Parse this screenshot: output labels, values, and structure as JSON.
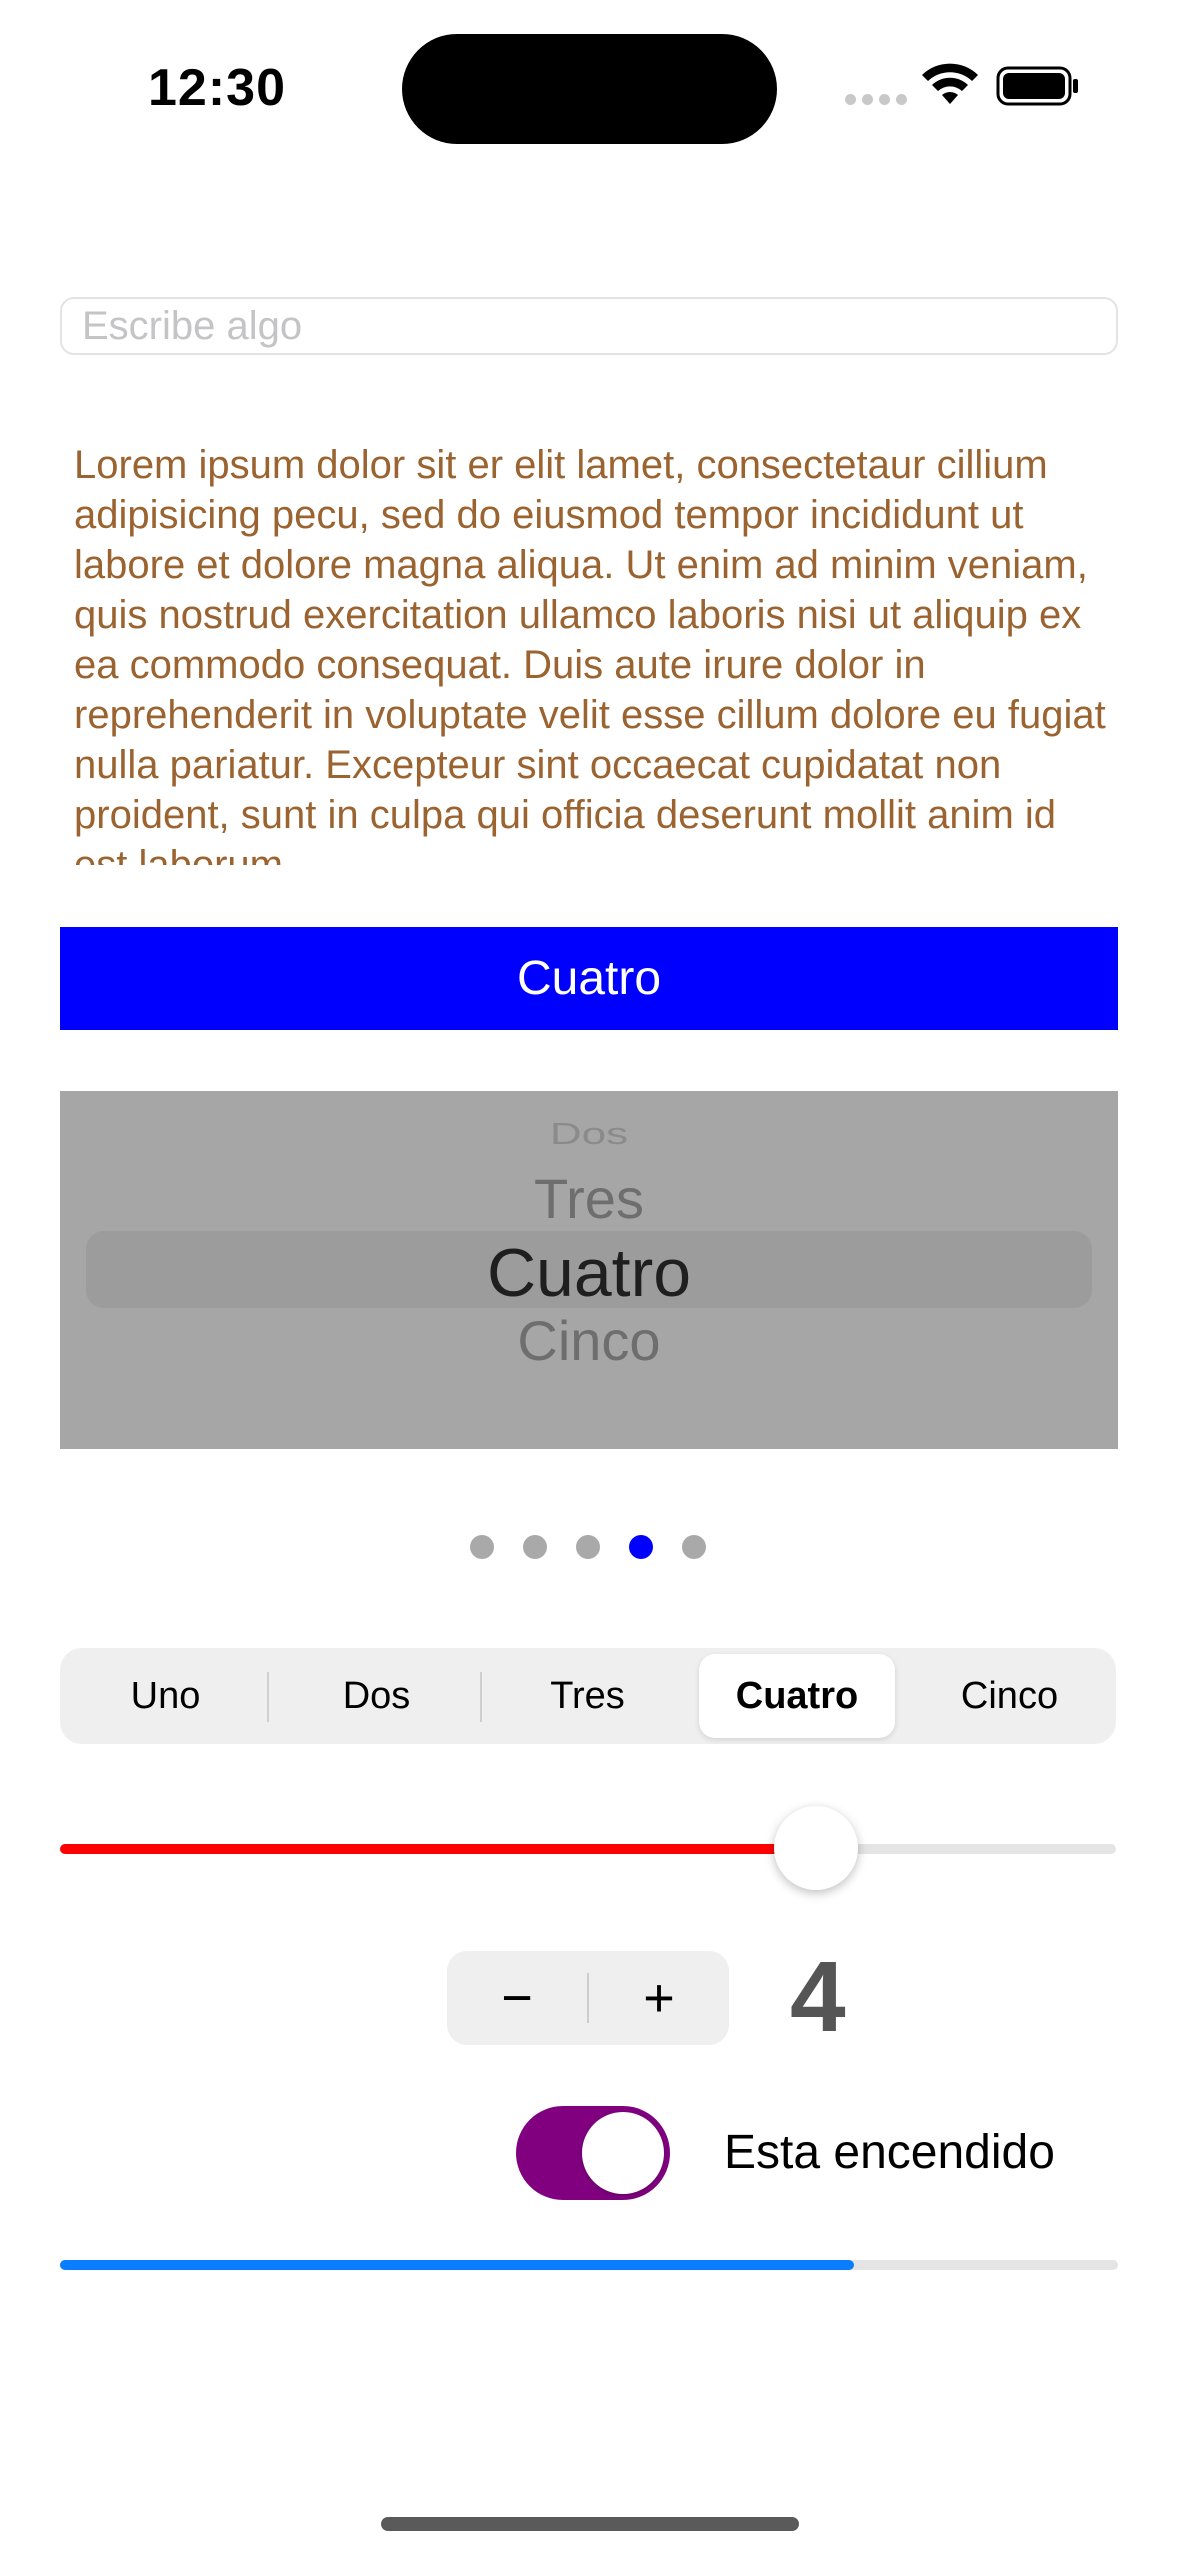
{
  "status_bar": {
    "time": "12:30"
  },
  "text_field": {
    "value": "",
    "placeholder": "Escribe algo"
  },
  "text_view": {
    "text": "Lorem ipsum dolor sit er elit lamet, consectetaur cillium adipisicing pecu, sed do eiusmod tempor incididunt ut labore et dolore magna aliqua. Ut enim ad minim veniam, quis nostrud exercitation ullamco laboris nisi ut aliquip ex ea commodo consequat. Duis aute irure dolor in reprehenderit in voluptate velit esse cillum dolore eu fugiat nulla pariatur. Excepteur sint occaecat cupidatat non proident, sunt in culpa qui officia deserunt mollit anim id est laborum."
  },
  "button": {
    "label": "Cuatro",
    "background": "#0000FF"
  },
  "picker": {
    "rows": [
      "Dos",
      "Tres",
      "Cuatro",
      "Cinco"
    ],
    "selected": "Cuatro"
  },
  "page_control": {
    "count": 5,
    "current_index": 3,
    "active_color": "#0000FF",
    "inactive_color": "#A9A9A9"
  },
  "segmented_control": {
    "segments": [
      "Uno",
      "Dos",
      "Tres",
      "Cuatro",
      "Cinco"
    ],
    "selected_index": 3
  },
  "slider": {
    "value": 0.735,
    "min_track_color": "#FF0000"
  },
  "stepper": {
    "minus_label": "−",
    "plus_label": "+",
    "value": "4"
  },
  "switch": {
    "on": true,
    "on_color": "#800080",
    "label": "Esta encendido"
  },
  "progress": {
    "value": 0.75,
    "tint_color": "#0A7CFF"
  }
}
